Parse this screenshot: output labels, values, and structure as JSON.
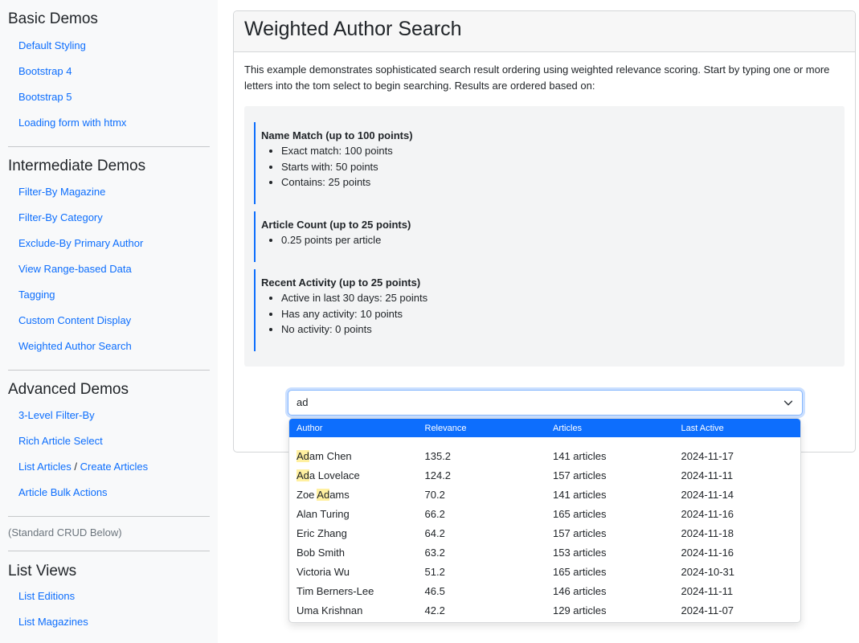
{
  "sidebar": {
    "sections": [
      {
        "heading": "Basic Demos",
        "links": [
          "Default Styling",
          "Bootstrap 4",
          "Bootstrap 5",
          "Loading form with htmx"
        ]
      },
      {
        "heading": "Intermediate Demos",
        "links": [
          "Filter-By Magazine",
          "Filter-By Category",
          "Exclude-By Primary Author",
          "View Range-based Data",
          "Tagging",
          "Custom Content Display",
          "Weighted Author Search"
        ]
      },
      {
        "heading": "Advanced Demos",
        "links": [
          "3-Level Filter-By",
          "Rich Article Select"
        ],
        "combo_link": {
          "left": "List Articles",
          "separator": "/",
          "right": "Create Articles"
        },
        "links_after": [
          "Article Bulk Actions"
        ]
      }
    ],
    "crud_note": "(Standard CRUD Below)",
    "list_views": {
      "heading": "List Views",
      "links": [
        "List Editions",
        "List Magazines"
      ]
    }
  },
  "main": {
    "title": "Weighted Author Search",
    "intro": "This example demonstrates sophisticated search result ordering using weighted relevance scoring. Start by typing one or more letters into the tom select to begin searching. Results are ordered based on:",
    "rules": [
      {
        "title": "Name Match (up to 100 points)",
        "items": [
          "Exact match: 100 points",
          "Starts with: 50 points",
          "Contains: 25 points"
        ]
      },
      {
        "title": "Article Count (up to 25 points)",
        "items": [
          "0.25 points per article"
        ]
      },
      {
        "title": "Recent Activity (up to 25 points)",
        "items": [
          "Active in last 30 days: 25 points",
          "Has any activity: 10 points",
          "No activity: 0 points"
        ]
      }
    ]
  },
  "search": {
    "value": "ad",
    "chevron_icon": "chevron-down-icon",
    "columns": [
      "Author",
      "Relevance",
      "Articles",
      "Last Active"
    ],
    "results": [
      {
        "name_hl": "Ad",
        "name_pre": "",
        "name_post": "am Chen",
        "relevance": "135.2",
        "articles": "141 articles",
        "last_active": "2024-11-17"
      },
      {
        "name_hl": "Ad",
        "name_pre": "",
        "name_post": "a Lovelace",
        "relevance": "124.2",
        "articles": "157 articles",
        "last_active": "2024-11-11"
      },
      {
        "name_hl": "Ad",
        "name_pre": "Zoe ",
        "name_post": "ams",
        "relevance": "70.2",
        "articles": "141 articles",
        "last_active": "2024-11-14"
      },
      {
        "name_hl": "",
        "name_pre": "Alan Turing",
        "name_post": "",
        "relevance": "66.2",
        "articles": "165 articles",
        "last_active": "2024-11-16"
      },
      {
        "name_hl": "",
        "name_pre": "Eric Zhang",
        "name_post": "",
        "relevance": "64.2",
        "articles": "157 articles",
        "last_active": "2024-11-18"
      },
      {
        "name_hl": "",
        "name_pre": "Bob Smith",
        "name_post": "",
        "relevance": "63.2",
        "articles": "153 articles",
        "last_active": "2024-11-16"
      },
      {
        "name_hl": "",
        "name_pre": "Victoria Wu",
        "name_post": "",
        "relevance": "51.2",
        "articles": "165 articles",
        "last_active": "2024-10-31"
      },
      {
        "name_hl": "",
        "name_pre": "Tim Berners-Lee",
        "name_post": "",
        "relevance": "46.5",
        "articles": "146 articles",
        "last_active": "2024-11-11"
      },
      {
        "name_hl": "",
        "name_pre": "Uma Krishnan",
        "name_post": "",
        "relevance": "42.2",
        "articles": "129 articles",
        "last_active": "2024-11-07"
      }
    ]
  },
  "colors": {
    "accent": "#0d6efd",
    "highlight": "#fff0a0",
    "sidebar_bg": "#f8f9fa"
  }
}
